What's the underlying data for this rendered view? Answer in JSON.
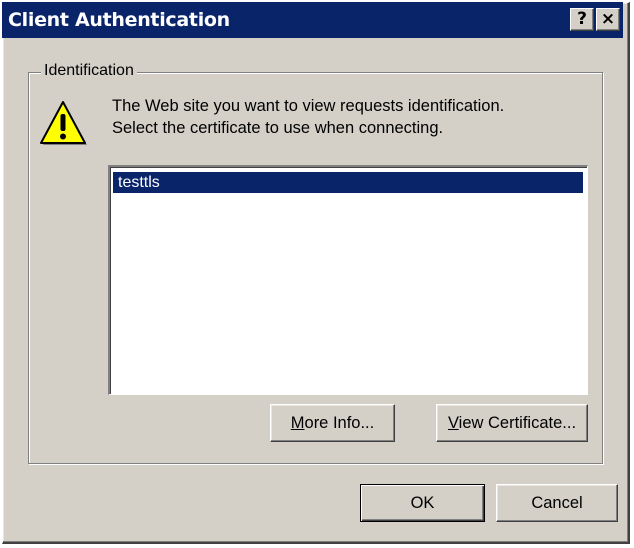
{
  "window": {
    "title": "Client Authentication",
    "help_button": "?",
    "close_button": "×"
  },
  "identification": {
    "group_label": "Identification",
    "icon": "warning-icon",
    "message_line1": "The Web site you want to view requests identification.",
    "message_line2": "Select the certificate to use when connecting."
  },
  "certificates": {
    "items": [
      "testtls"
    ],
    "selected": "testtls"
  },
  "buttons": {
    "more_info": {
      "accel": "M",
      "rest": "ore Info..."
    },
    "view_certificate": {
      "accel": "V",
      "rest": "iew Certificate..."
    },
    "ok": "OK",
    "cancel": "Cancel"
  },
  "colors": {
    "titlebar": "#0a246a",
    "face": "#d4d0c8",
    "selection": "#0a246a",
    "warning": "#ffff00"
  }
}
